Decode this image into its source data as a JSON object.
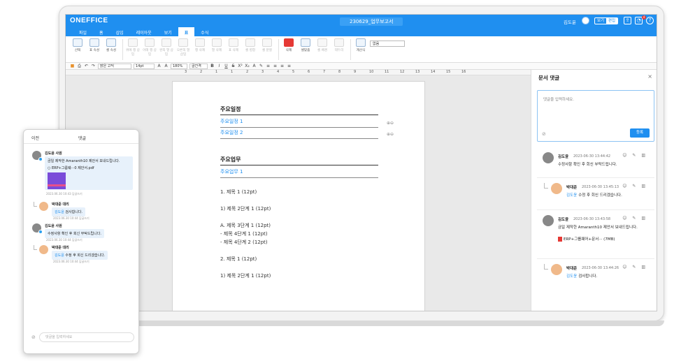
{
  "app": {
    "logo": "ONEFFICE",
    "doc_title": "230629_업무보고서",
    "user": "김도윤"
  },
  "toggle": {
    "left": "보기",
    "right": "편집"
  },
  "menu": [
    "파일",
    "홈",
    "삽입",
    "레이아웃",
    "보기",
    "표",
    "수식"
  ],
  "ribbon": [
    {
      "label": "선택",
      "dim": false
    },
    {
      "label": "표 속성",
      "dim": false
    },
    {
      "label": "셀 속성",
      "dim": false
    },
    {
      "label": "위에 행 삽입",
      "dim": true
    },
    {
      "label": "아래 행 삽입",
      "dim": true
    },
    {
      "label": "왼쪽 열 삽입",
      "dim": true
    },
    {
      "label": "오른쪽 열 삽입",
      "dim": true
    },
    {
      "label": "행 삭제",
      "dim": true
    },
    {
      "label": "열 삭제",
      "dim": true
    },
    {
      "label": "표 삭제",
      "dim": true
    },
    {
      "label": "셀 병합",
      "dim": true
    },
    {
      "label": "셀 분할",
      "dim": true
    },
    {
      "label": "삭제",
      "dim": false
    },
    {
      "label": "셀맞춤",
      "dim": false
    },
    {
      "label": "셀 배경",
      "dim": true
    },
    {
      "label": "테두리",
      "dim": true
    },
    {
      "label": "계산식",
      "dim": false
    }
  ],
  "ribbon_select": "없음",
  "fmt": {
    "font": "맑은 고딕",
    "size": "14pt",
    "line": "180%",
    "spacing": "글간격"
  },
  "ruler": [
    "3",
    "2",
    "1",
    "1",
    "2",
    "3",
    "4",
    "5",
    "6",
    "7",
    "8",
    "9",
    "10",
    "11",
    "12",
    "13",
    "14",
    "15",
    "16"
  ],
  "doc": {
    "sec1_title": "주요일정",
    "sec1_items": [
      "주요일정 1",
      "주요일정 2"
    ],
    "sec2_title": "주요업무",
    "sec2_items": [
      "주요업무 1"
    ],
    "body": [
      "1. 제목 1 (12pt)",
      "",
      "1) 제목 2단계 1 (12pt)",
      "",
      "A. 제목 3단계 1 (12pt)",
      "- 제목 4단계 1 (12pt)",
      "- 제목 4단계 2 (12pt)",
      "",
      "2. 제목 1 (12pt)",
      "",
      "1) 제목 2단계 1 (12pt)"
    ]
  },
  "comments_panel": {
    "title": "문서 댓글",
    "placeholder": "댓글을 입력하세요.",
    "submit": "등록",
    "items": [
      {
        "name": "김도윤",
        "date": "2023-06-30 13:44:42",
        "mention": "",
        "text": "수정사항 확인 후 회신 부탁드립니다.",
        "reply": false
      },
      {
        "name": "박대준",
        "date": "2023-06-30 13:45:13",
        "mention": "김도윤",
        "text": "수정 후 회신 드리겠습니다.",
        "reply": true
      },
      {
        "name": "김도윤",
        "date": "2023-06-30 13:43:58",
        "mention": "",
        "text": "금일 제작한 Amaranth10 제안서 보내드립니다.",
        "file": "ERP+그룹웨어+문서···  (7MB)",
        "reply": false
      },
      {
        "name": "박대준",
        "date": "2023-06-30 13:44:26",
        "mention": "김도윤",
        "text": "검사합니다.",
        "reply": true
      }
    ]
  },
  "side_panel": {
    "back": "이전",
    "title": "댓글",
    "input_placeholder": "댓글을 입력하세요",
    "items": [
      {
        "name": "김도윤 사원",
        "text": "금일 제작한 Amaranth10 제안서 보내드립니다.",
        "file": "ERP+그룹웨···0 제안서.pdf",
        "meta": "2023.06.30 10:43   답글쓰기",
        "reply": false
      },
      {
        "name": "박대준 대리",
        "mention": "김도윤",
        "text": "검사합니다.",
        "meta": "2023.06.30 10:44   답글쓰기",
        "reply": true
      },
      {
        "name": "김도윤 사원",
        "text": "수정사항 확인 후 회신 부탁드립니다.",
        "meta": "2023.06.30 10:44   답글쓰기",
        "reply": false
      },
      {
        "name": "박대준 대리",
        "mention": "김도윤",
        "text": "수정 후 회신 드리겠습니다.",
        "meta": "2023.06.30 10:44   답글쓰기",
        "reply": true
      }
    ]
  }
}
